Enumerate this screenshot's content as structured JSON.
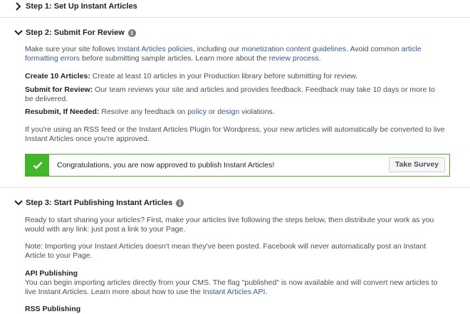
{
  "step1": {
    "title": "Step 1: Set Up Instant Articles"
  },
  "step2": {
    "title": "Step 2: Submit For Review",
    "intro": {
      "t1": "Make sure your site follows ",
      "link1": "Instant Articles policies",
      "t2": ", including our ",
      "link2": "monetization content guidelines",
      "t3": ". Avoid common ",
      "link3": "article formatting errors",
      "t4": " before submitting sample articles. Learn more about the ",
      "link4": "review process",
      "t5": "."
    },
    "create": {
      "label": "Create 10 Articles:",
      "text": " Create at least 10 articles in your Production library before submitting for review."
    },
    "submit": {
      "label": "Submit for Review:",
      "text": " Our team reviews your site and articles and provides feedback. Feedback may take 10 days or more to be delivered."
    },
    "resubmit": {
      "label": "Resubmit, If Needed:",
      "t1": " Resolve any feedback on ",
      "link1": "policy",
      "t2": " or ",
      "link2": "design",
      "t3": " violations."
    },
    "rss_note": "If you're using an RSS feed or the Instant Articles Plugin for Wordpress, your new articles will automatically be converted to live Instant Articles once you're approved.",
    "banner": {
      "text": "Congratulations, you are now approved to publish Instant Articles!",
      "button": "Take Survey",
      "color": "#42b72a"
    }
  },
  "step3": {
    "title": "Step 3: Start Publishing Instant Articles",
    "ready": "Ready to start sharing your articles? First, make your articles live following the steps below, then distribute your work as you would with any link: just post a link to your Page.",
    "note": "Note: Importing your Instant Articles doesn't mean they've been posted. Facebook will never automatically post an Instant Article to your Page.",
    "api": {
      "heading": "API Publishing",
      "t1": "You can begin importing articles directly from your CMS. The flag \"published\" is now available and will convert new articles to live Instant Articles. Learn more about how to use the ",
      "link": "Instant Articles API",
      "t2": "."
    },
    "rss": {
      "heading": "RSS Publishing"
    }
  },
  "colors": {
    "link": "#365899",
    "text": "#4b4f56",
    "heading": "#1d2129",
    "success": "#42b72a"
  }
}
